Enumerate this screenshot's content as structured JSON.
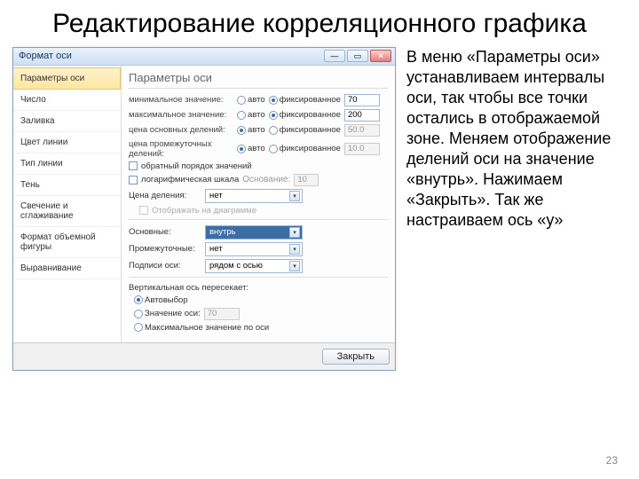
{
  "title": "Редактирование корреляционного графика",
  "page_number": "23",
  "body_text": "В меню «Параметры оси» устанавливаем интервалы оси, так чтобы все точки остались в отображаемой зоне. Меняем отображение делений оси на значение «внутрь». Нажимаем «Закрыть». Так же настраиваем ось «y»",
  "dialog": {
    "title": "Формат оси",
    "close_button": "Закрыть",
    "sidebar": {
      "items": [
        "Параметры оси",
        "Число",
        "Заливка",
        "Цвет линии",
        "Тип линии",
        "Тень",
        "Свечение и сглаживание",
        "Формат объемной фигуры",
        "Выравнивание"
      ],
      "selected": 0
    },
    "panel": {
      "heading": "Параметры оси",
      "limits": [
        {
          "label": "минимальное значение:",
          "auto": false,
          "fixed": true,
          "value": "70"
        },
        {
          "label": "максимальное значение:",
          "auto": false,
          "fixed": true,
          "value": "200"
        },
        {
          "label": "цена основных делений:",
          "auto": true,
          "fixed": false,
          "value": "50.0"
        },
        {
          "label": "цена промежуточных делений:",
          "auto": true,
          "fixed": false,
          "value": "10.0"
        }
      ],
      "radio_auto": "авто",
      "radio_fixed": "фиксированное",
      "reverse_label": "обратный порядок значений",
      "log_label": "логарифмическая шкала",
      "log_base_label": "Основание:",
      "log_base_value": "10",
      "unit_label": "Цена деления:",
      "unit_value": "нет",
      "display_label": "Отображать на диаграмме",
      "major_label": "Основные:",
      "major_value": "внутрь",
      "minor_label": "Промежуточные:",
      "minor_value": "нет",
      "axis_labels_label": "Подписи оси:",
      "axis_labels_value": "рядом с осью",
      "cross_heading": "Вертикальная ось пересекает:",
      "cross_auto": "Автовыбор",
      "cross_val": "Значение оси:",
      "cross_val_value": "70",
      "cross_max": "Максимальное значение по оси"
    }
  }
}
